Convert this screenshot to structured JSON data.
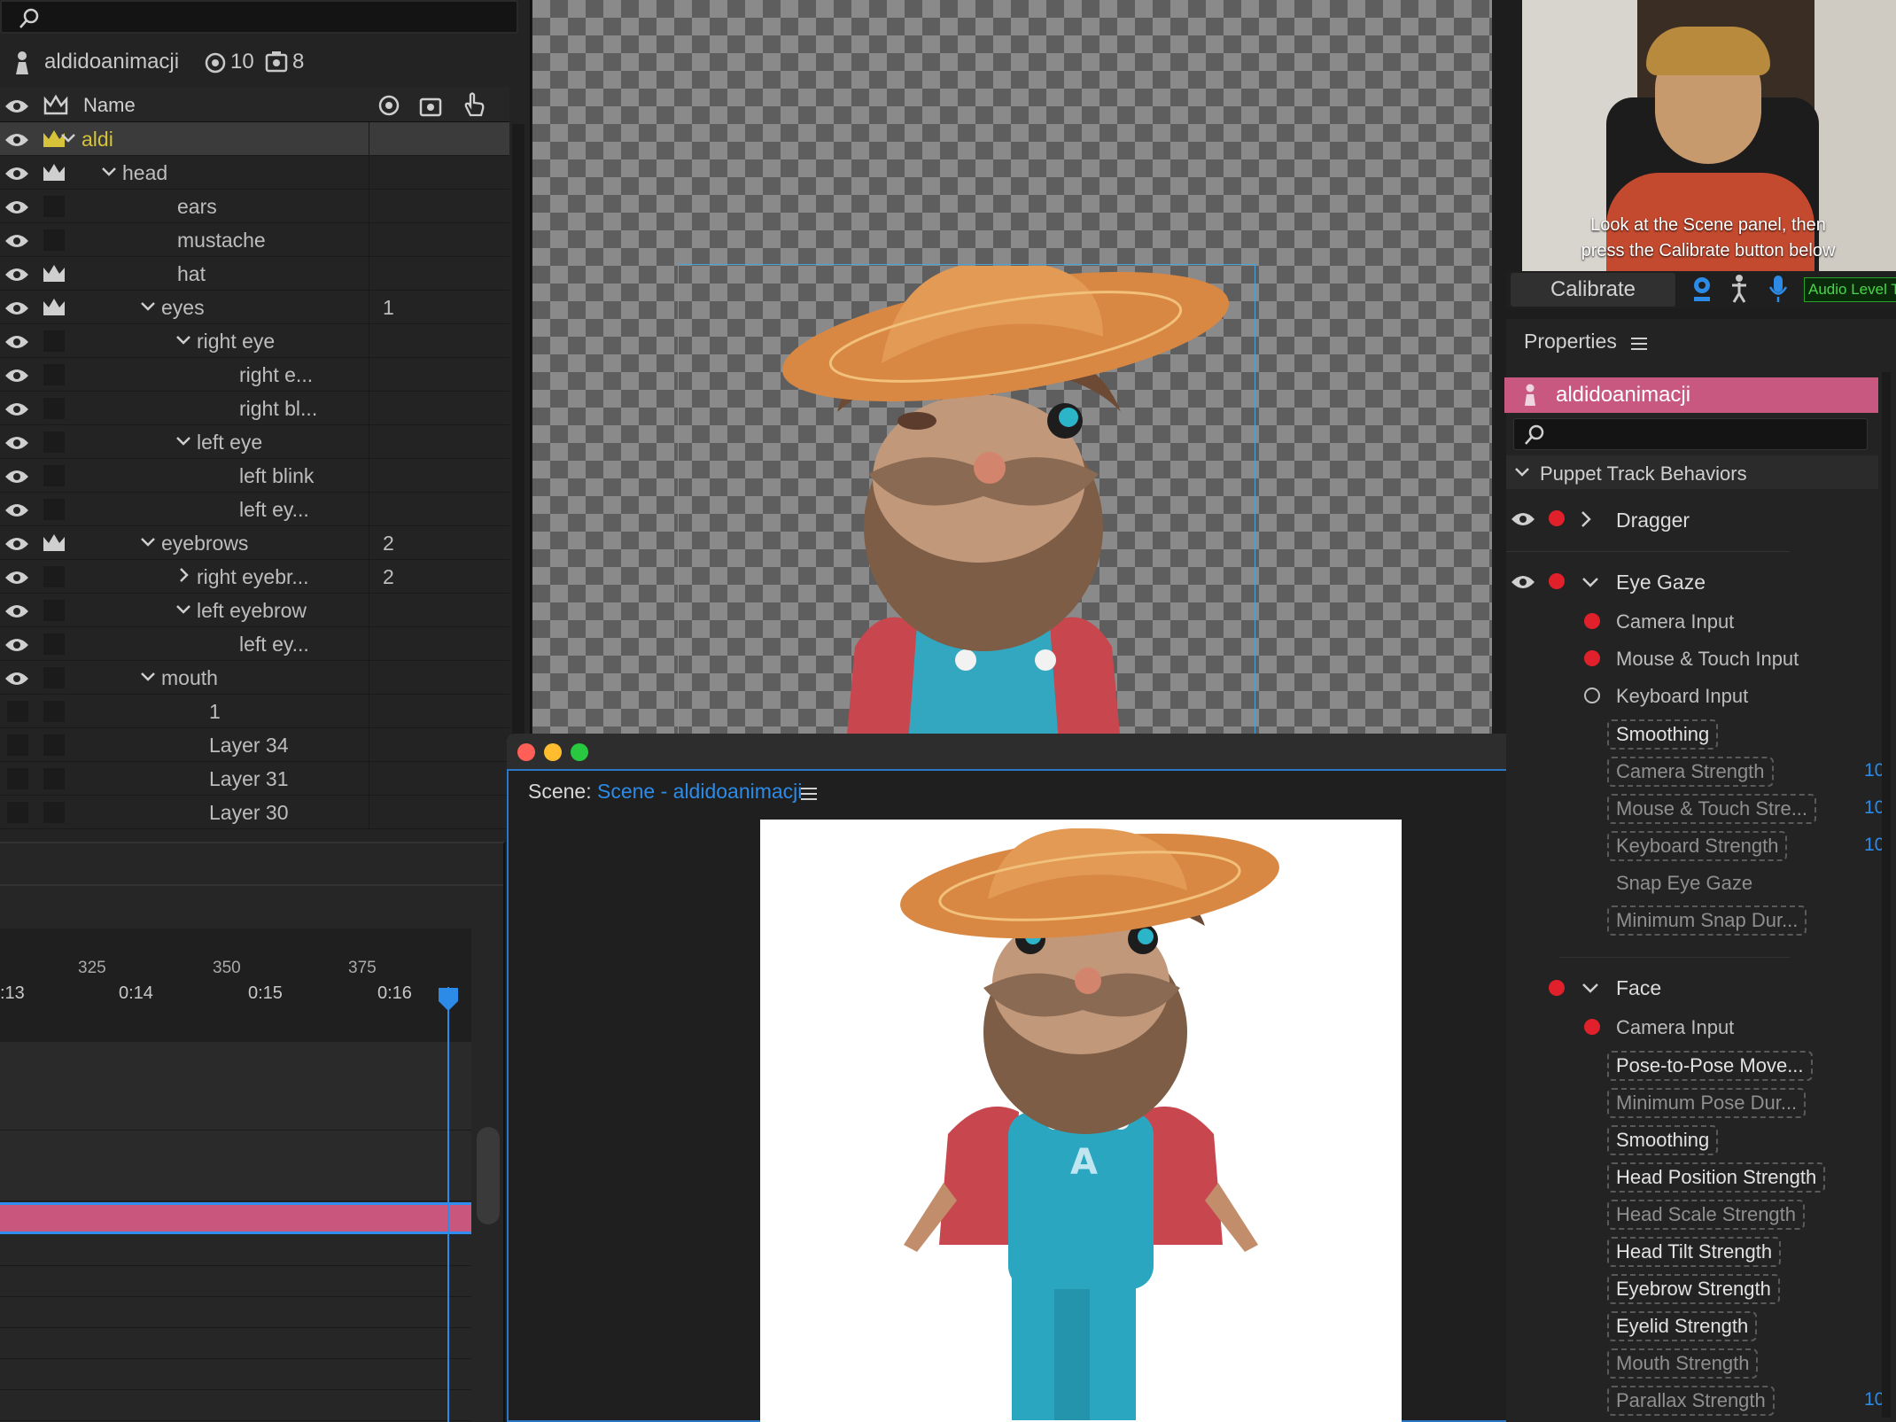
{
  "puppet_panel": {
    "search_placeholder": "",
    "puppet_name": "aldidoanimacji",
    "count_a": "10",
    "count_b": "8",
    "col_name": "Name",
    "layers": [
      {
        "label": "aldi",
        "count": ""
      },
      {
        "label": "head",
        "count": ""
      },
      {
        "label": "ears",
        "count": ""
      },
      {
        "label": "mustache",
        "count": ""
      },
      {
        "label": "hat",
        "count": ""
      },
      {
        "label": "eyes",
        "count": "1"
      },
      {
        "label": "right eye",
        "count": ""
      },
      {
        "label": "right e...",
        "count": ""
      },
      {
        "label": "right bl...",
        "count": ""
      },
      {
        "label": "left eye",
        "count": ""
      },
      {
        "label": "left blink",
        "count": ""
      },
      {
        "label": "left ey...",
        "count": ""
      },
      {
        "label": "eyebrows",
        "count": "2"
      },
      {
        "label": "right eyebr...",
        "count": "2"
      },
      {
        "label": "left eyebrow",
        "count": ""
      },
      {
        "label": "left ey...",
        "count": ""
      },
      {
        "label": "mouth",
        "count": ""
      },
      {
        "label": "1",
        "count": ""
      },
      {
        "label": "Layer 34",
        "count": ""
      },
      {
        "label": "Layer 31",
        "count": ""
      },
      {
        "label": "Layer 30",
        "count": ""
      }
    ]
  },
  "timeline": {
    "frame_ticks": [
      "325",
      "350",
      "375"
    ],
    "time_ticks": [
      ":13",
      "0:14",
      "0:15",
      "0:16"
    ]
  },
  "scene": {
    "prefix": "Scene:",
    "name": "Scene - aldidoanimacji"
  },
  "camera": {
    "instruction_line1": "Look at the Scene panel, then",
    "instruction_line2": "press the Calibrate button below",
    "calibrate_label": "Calibrate",
    "audio_label": "Audio Level T"
  },
  "properties": {
    "title": "Properties",
    "puppet_name": "aldidoanimacji",
    "search_placeholder": "",
    "section": "Puppet Track Behaviors",
    "dragger": "Dragger",
    "eye_gaze": {
      "label": "Eye Gaze",
      "inputs": [
        "Camera Input",
        "Mouse & Touch Input",
        "Keyboard Input"
      ],
      "params": [
        "Smoothing",
        "Camera Strength",
        "Mouse & Touch Stre...",
        "Keyboard Strength",
        "Snap Eye Gaze",
        "Minimum Snap Dur..."
      ],
      "values": [
        "",
        "10",
        "10",
        "10",
        "",
        ""
      ]
    },
    "face": {
      "label": "Face",
      "input": "Camera Input",
      "params": [
        "Pose-to-Pose Move...",
        "Minimum Pose Dur...",
        "Smoothing",
        "Head Position Strength",
        "Head Scale Strength",
        "Head Tilt Strength",
        "Eyebrow Strength",
        "Eyelid Strength",
        "Mouth Strength",
        "Parallax Strength"
      ],
      "values": [
        "",
        "",
        "",
        "",
        "",
        "",
        "",
        "",
        "",
        "10"
      ]
    }
  },
  "colors": {
    "accent_blue": "#2d8be8",
    "puppet_pink": "#c8587f",
    "record_red": "#e0202a",
    "selected_yellow": "#d6c33a"
  }
}
